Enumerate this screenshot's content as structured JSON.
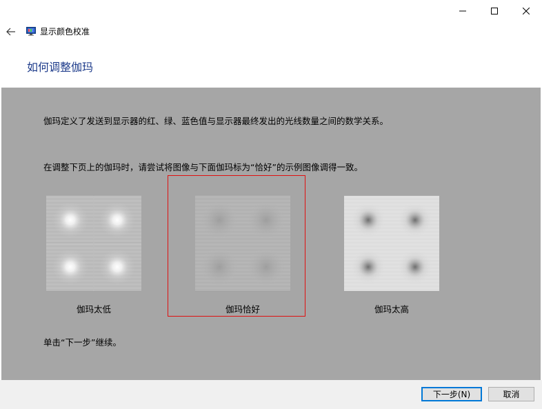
{
  "window": {
    "app_title": "显示颜色校准",
    "app_icon": "monitor-calibration-icon",
    "controls": {
      "minimize": "minimize-icon",
      "maximize": "maximize-icon",
      "close": "close-icon"
    }
  },
  "nav": {
    "back_icon": "back-arrow-icon"
  },
  "page": {
    "title": "如何调整伽玛",
    "paragraph1": "伽玛定义了发送到显示器的红、绿、蓝色值与显示器最终发出的光线数量之间的数学关系。",
    "paragraph2": "在调整下页上的伽玛时，请尝试将图像与下面伽玛标为“恰好”的示例图像调得一致。",
    "paragraph3": "单击“下一步”继续。"
  },
  "samples": [
    {
      "label": "伽玛太低",
      "selected": false
    },
    {
      "label": "伽玛恰好",
      "selected": true
    },
    {
      "label": "伽玛太高",
      "selected": false
    }
  ],
  "colors": {
    "content_bg": "#a6a6a6",
    "title_blue": "#1c3a8a",
    "highlight_red": "#e01010",
    "accent": "#0078d7"
  },
  "footer": {
    "next_label": "下一步(N)",
    "cancel_label": "取消"
  }
}
